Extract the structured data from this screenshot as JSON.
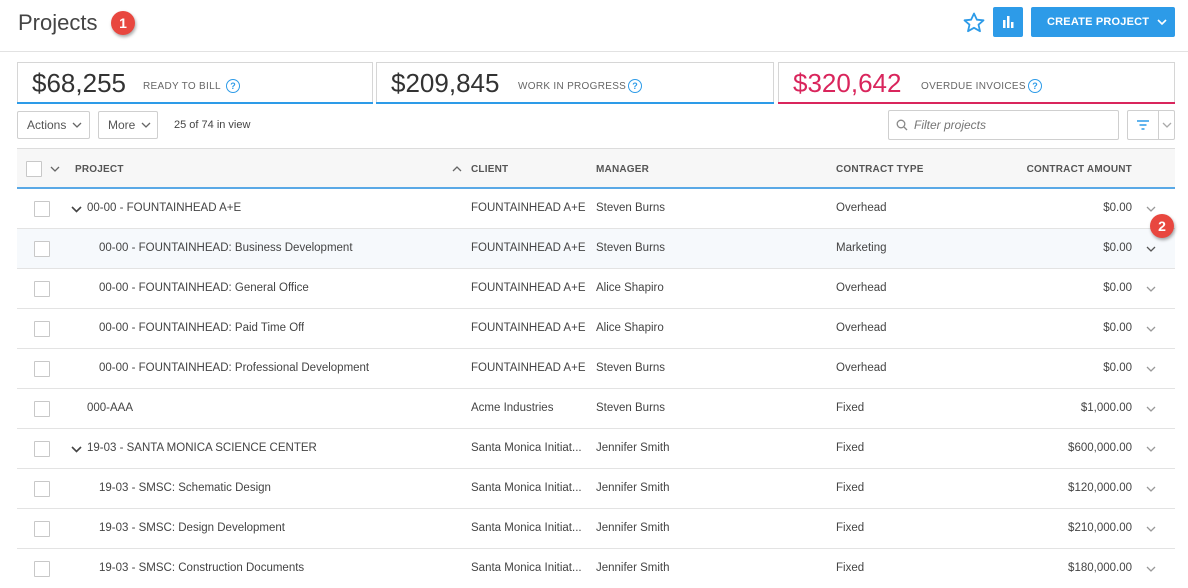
{
  "header": {
    "title": "Projects",
    "create_label": "CREATE PROJECT",
    "accent_color": "#2d9be8"
  },
  "callouts": {
    "one": "1",
    "two": "2"
  },
  "kpis": [
    {
      "value": "$68,255",
      "label": "READY TO BILL",
      "color": "#2d9be8"
    },
    {
      "value": "$209,845",
      "label": "WORK IN PROGRESS",
      "color": "#2d9be8"
    },
    {
      "value": "$320,642",
      "label": "OVERDUE INVOICES",
      "color": "#d9255c"
    }
  ],
  "toolbar": {
    "actions_label": "Actions",
    "more_label": "More",
    "view_count": "25 of 74 in view",
    "filter_placeholder": "Filter projects"
  },
  "table": {
    "columns": {
      "project": "PROJECT",
      "client": "CLIENT",
      "manager": "MANAGER",
      "contract_type": "CONTRACT TYPE",
      "contract_amount": "CONTRACT AMOUNT"
    },
    "rows": [
      {
        "project": "00-00 - FOUNTAINHEAD A+E",
        "client": "FOUNTAINHEAD A+E",
        "manager": "Steven Burns",
        "contract_type": "Overhead",
        "amount": "$0.00",
        "level": 0,
        "expandable": true
      },
      {
        "project": "00-00 - FOUNTAINHEAD: Business Development",
        "client": "FOUNTAINHEAD A+E",
        "manager": "Steven Burns",
        "contract_type": "Marketing",
        "amount": "$0.00",
        "level": 1,
        "expandable": false
      },
      {
        "project": "00-00 - FOUNTAINHEAD: General Office",
        "client": "FOUNTAINHEAD A+E",
        "manager": "Alice Shapiro",
        "contract_type": "Overhead",
        "amount": "$0.00",
        "level": 1,
        "expandable": false
      },
      {
        "project": "00-00 - FOUNTAINHEAD: Paid Time Off",
        "client": "FOUNTAINHEAD A+E",
        "manager": "Alice Shapiro",
        "contract_type": "Overhead",
        "amount": "$0.00",
        "level": 1,
        "expandable": false
      },
      {
        "project": "00-00 - FOUNTAINHEAD: Professional Development",
        "client": "FOUNTAINHEAD A+E",
        "manager": "Steven Burns",
        "contract_type": "Overhead",
        "amount": "$0.00",
        "level": 1,
        "expandable": false
      },
      {
        "project": "000-AAA",
        "client": "Acme Industries",
        "manager": "Steven Burns",
        "contract_type": "Fixed",
        "amount": "$1,000.00",
        "level": 0,
        "expandable": false
      },
      {
        "project": "19-03 - SANTA MONICA SCIENCE CENTER",
        "client": "Santa Monica Initiat...",
        "manager": "Jennifer Smith",
        "contract_type": "Fixed",
        "amount": "$600,000.00",
        "level": 0,
        "expandable": true
      },
      {
        "project": "19-03 - SMSC: Schematic Design",
        "client": "Santa Monica Initiat...",
        "manager": "Jennifer Smith",
        "contract_type": "Fixed",
        "amount": "$120,000.00",
        "level": 1,
        "expandable": false
      },
      {
        "project": "19-03 - SMSC: Design Development",
        "client": "Santa Monica Initiat...",
        "manager": "Jennifer Smith",
        "contract_type": "Fixed",
        "amount": "$210,000.00",
        "level": 1,
        "expandable": false
      },
      {
        "project": "19-03 - SMSC: Construction Documents",
        "client": "Santa Monica Initiat...",
        "manager": "Jennifer Smith",
        "contract_type": "Fixed",
        "amount": "$180,000.00",
        "level": 1,
        "expandable": false
      }
    ]
  }
}
